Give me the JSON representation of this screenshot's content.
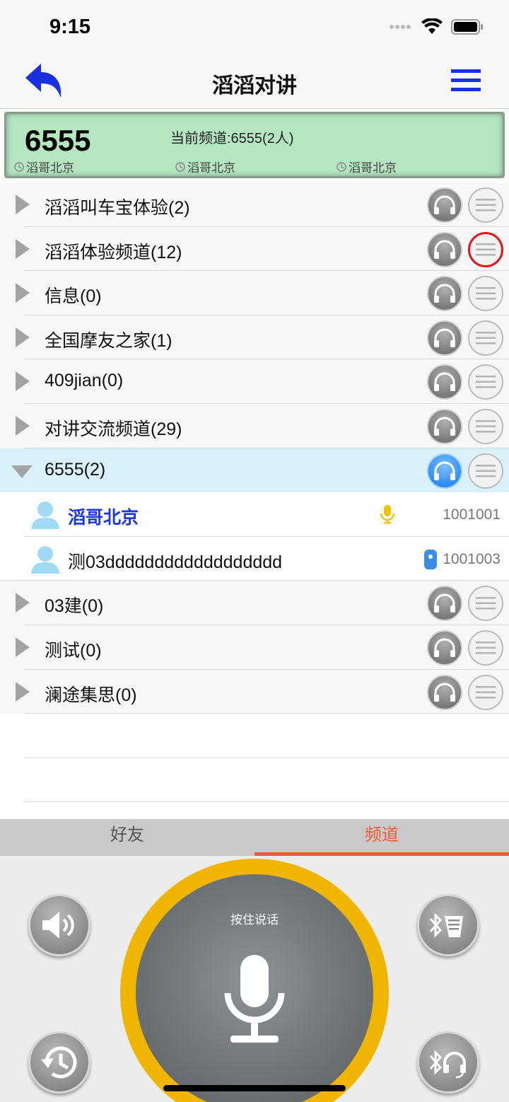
{
  "status_bar": {
    "time": "9:15"
  },
  "nav": {
    "title": "滔滔对讲",
    "back_icon": "back-arrow-icon",
    "menu_icon": "hamburger-menu-icon",
    "accent_color": "#1a2fe0"
  },
  "channel_panel": {
    "number": "6555",
    "current_channel": "当前频道:6555(2人)",
    "history": [
      "滔哥北京",
      "滔哥北京",
      "滔哥北京"
    ]
  },
  "groups_before": [
    {
      "name": "滔滔叫车宝体验(2)"
    },
    {
      "name": "滔滔体验频道(12)",
      "menu_highlight": true
    },
    {
      "name": "信息(0)"
    },
    {
      "name": "全国摩友之家(1)"
    },
    {
      "name": "409jian(0)"
    },
    {
      "name": "对讲交流频道(29)"
    }
  ],
  "expanded_group": {
    "name": "6555(2)"
  },
  "members": [
    {
      "name": "滔哥北京",
      "id": "1001001",
      "status_icon": "microphone-icon"
    },
    {
      "name": "测03dddddddddddddddddd",
      "id": "1001003",
      "status_icon": "device-icon"
    }
  ],
  "groups_after": [
    {
      "name": "03建(0)"
    },
    {
      "name": "测试(0)"
    },
    {
      "name": "澜途集思(0)"
    }
  ],
  "tabs": {
    "friends": "好友",
    "channels": "频道",
    "active": "channels",
    "active_color": "#f15a36"
  },
  "ptt": {
    "label": "按住说话",
    "ring_color": "#f0b500"
  },
  "controls": [
    "speaker-icon",
    "history-icon",
    "bluetooth-radio-icon",
    "bluetooth-headset-icon"
  ]
}
